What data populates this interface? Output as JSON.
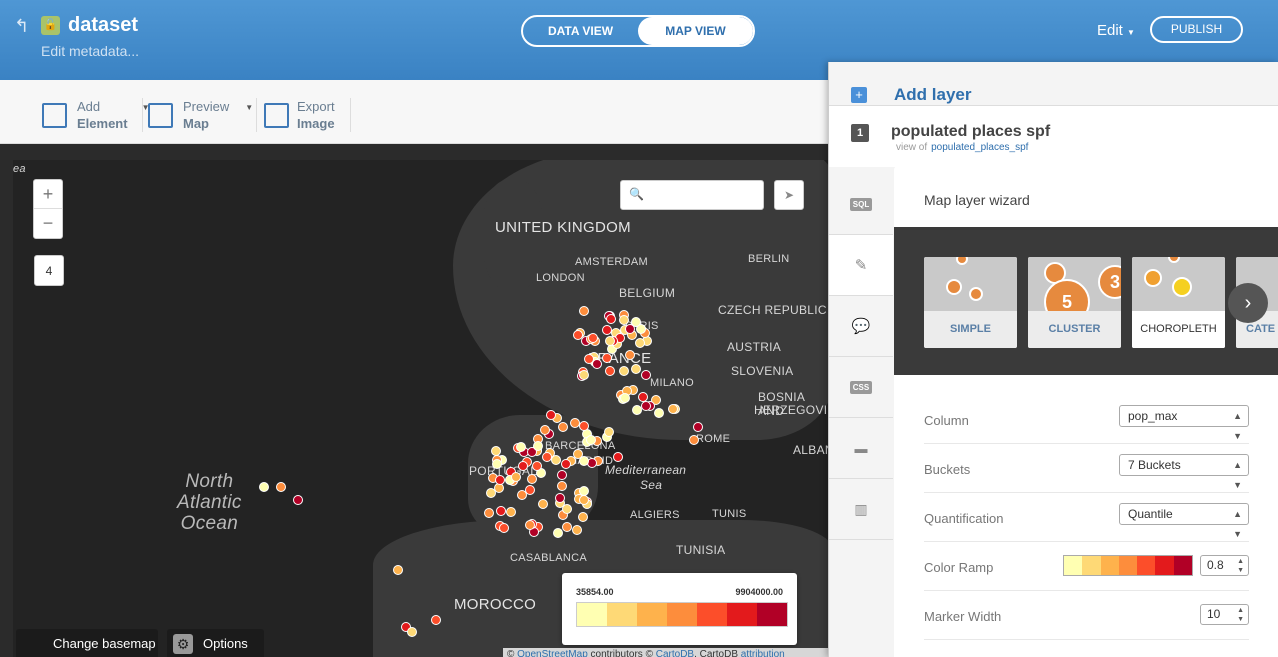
{
  "header": {
    "title": "dataset",
    "subtitle": "Edit metadata...",
    "views": [
      "DATA VIEW",
      "MAP VIEW"
    ],
    "edit_label": "Edit",
    "publish_label": "PUBLISH"
  },
  "toolbar": {
    "add_element": [
      "Add",
      "Element"
    ],
    "preview_map": [
      "Preview",
      "Map"
    ],
    "export_image": [
      "Export",
      "Image"
    ]
  },
  "map": {
    "zoom_in": "+",
    "zoom_out": "−",
    "zoom_level": "4",
    "corner_text": "ea",
    "labels": [
      "UNITED KINGDOM",
      "AMSTERDAM",
      "BERLIN",
      "LONDON",
      "BELGIUM",
      "CZECH REPUBLIC",
      "PARIS",
      "FRANCE",
      "AUSTRIA",
      "SLOVENIA",
      "MILANO",
      "BOSNIA AND",
      "HERZEGOVINA",
      "ROME",
      "ALBAN",
      "BARCELONA",
      "PORTUGAL",
      "MADRID",
      "Mediterranean",
      "Sea",
      "ALGIERS",
      "TUNIS",
      "TUNISIA",
      "CASABLANCA",
      "MOROCCO"
    ],
    "ocean": [
      "North",
      "Atlantic",
      "Ocean"
    ],
    "legend": {
      "min": "35854.00",
      "max": "9904000.00"
    },
    "change_basemap": "Change basemap",
    "options": "Options",
    "attribution": {
      "prefix": "©",
      "osm": "OpenStreetMap",
      "contributors": "contributors ©",
      "cartodb": "CartoDB",
      "middle": ", CartoDB",
      "attr": "attribution"
    }
  },
  "panel": {
    "add_layer": "Add layer",
    "layer_number": "1",
    "layer_name": "populated places spf",
    "view_of": "view of",
    "view_of_link": "populated_places_spf",
    "side_tabs": [
      "SQL",
      "CSS"
    ],
    "wizard_title": "Map layer wizard",
    "cards": [
      "SIMPLE",
      "CLUSTER",
      "CHOROPLETH",
      "CATE"
    ],
    "cluster_numbers": [
      "5",
      "3"
    ],
    "fields": [
      {
        "label": "Column",
        "value": "pop_max"
      },
      {
        "label": "Buckets",
        "value": "7 Buckets"
      },
      {
        "label": "Quantification",
        "value": "Quantile"
      },
      {
        "label": "Color Ramp",
        "value": "0.8"
      },
      {
        "label": "Marker Width",
        "value": "10"
      }
    ]
  },
  "colors": {
    "ramp": [
      "#ffffb2",
      "#fed976",
      "#feb24c",
      "#fd8d3c",
      "#fc4e2a",
      "#e31a1c",
      "#b10026"
    ],
    "accent": "#3a82c3"
  }
}
